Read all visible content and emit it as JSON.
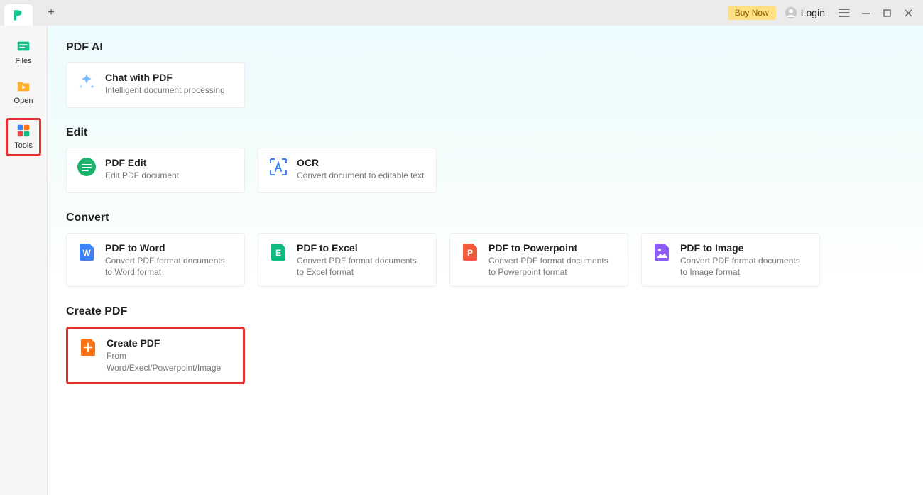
{
  "titlebar": {
    "buy_now": "Buy Now",
    "login": "Login"
  },
  "sidebar": {
    "items": [
      {
        "label": "Files"
      },
      {
        "label": "Open"
      },
      {
        "label": "Tools"
      }
    ]
  },
  "sections": {
    "pdf_ai": {
      "title": "PDF AI",
      "cards": [
        {
          "title": "Chat with PDF",
          "sub": "Intelligent document processing"
        }
      ]
    },
    "edit": {
      "title": "Edit",
      "cards": [
        {
          "title": "PDF Edit",
          "sub": "Edit PDF document"
        },
        {
          "title": "OCR",
          "sub": "Convert document to editable text"
        }
      ]
    },
    "convert": {
      "title": "Convert",
      "cards": [
        {
          "title": "PDF to Word",
          "sub": "Convert PDF format documents to Word format"
        },
        {
          "title": "PDF to Excel",
          "sub": "Convert PDF format documents to Excel format"
        },
        {
          "title": "PDF to Powerpoint",
          "sub": "Convert PDF format documents to Powerpoint format"
        },
        {
          "title": "PDF to Image",
          "sub": "Convert PDF format documents to Image format"
        }
      ]
    },
    "create": {
      "title": "Create PDF",
      "cards": [
        {
          "title": "Create PDF",
          "sub": "From Word/Execl/Powerpoint/Image"
        }
      ]
    }
  }
}
